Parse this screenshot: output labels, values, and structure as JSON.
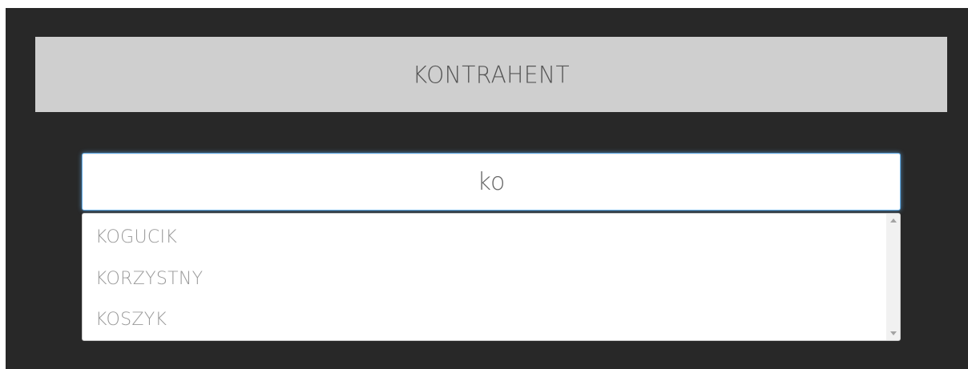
{
  "header": {
    "title": "KONTRAHENT"
  },
  "search": {
    "value": "ko",
    "placeholder": ""
  },
  "suggestions": {
    "items": [
      {
        "label": "KOGUCIK"
      },
      {
        "label": "KORZYSTNY"
      },
      {
        "label": "KOSZYK"
      }
    ]
  },
  "scrollbar": {
    "up_icon": "triangle-up-icon",
    "down_icon": "triangle-down-icon"
  },
  "colors": {
    "background": "#282828",
    "header_bar": "#cfcfcf",
    "input_focus_border": "#66afe9",
    "suggestion_text": "#9a9a9a"
  }
}
